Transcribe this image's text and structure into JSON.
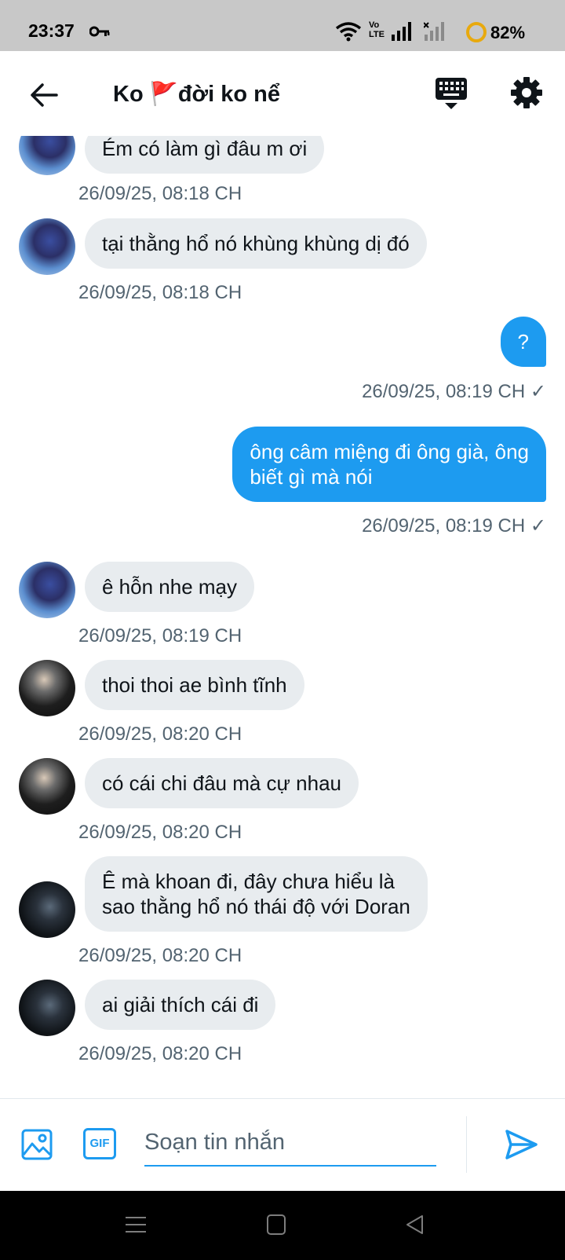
{
  "status_bar": {
    "time": "23:37",
    "volte_top": "Vo",
    "volte_bottom": "LTE",
    "battery": "82%"
  },
  "header": {
    "title": "Ko 🚩đời ko nể"
  },
  "messages": [
    {
      "dir": "in",
      "avatar": "avatar-blue",
      "text": "Ém có làm gì đâu m ơi",
      "time": "26/09/25, 08:18 CH"
    },
    {
      "dir": "in",
      "avatar": "avatar-blue",
      "text": "tại thằng hổ nó khùng khùng dị đó",
      "time": "26/09/25, 08:18 CH"
    },
    {
      "dir": "out",
      "text": "?",
      "time": "26/09/25, 08:19 CH ✓"
    },
    {
      "dir": "out",
      "text": "ông câm miệng đi ông già, ông\nbiết gì mà nói",
      "time": "26/09/25, 08:19 CH ✓"
    },
    {
      "dir": "in",
      "avatar": "avatar-blue",
      "text": "ê hỗn nhe mạy",
      "time": "26/09/25, 08:19 CH"
    },
    {
      "dir": "in",
      "avatar": "avatar-dark",
      "text": "thoi thoi ae bình tĩnh",
      "time": "26/09/25, 08:20 CH"
    },
    {
      "dir": "in",
      "avatar": "avatar-dark",
      "text": "có cái chi đâu mà cự nhau",
      "time": "26/09/25, 08:20 CH"
    },
    {
      "dir": "in",
      "avatar": "avatar-night",
      "text": "Ê mà khoan đi, đây chưa hiểu là\nsao thằng hổ nó thái độ với Doran",
      "time": "26/09/25, 08:20 CH"
    },
    {
      "dir": "in",
      "avatar": "avatar-night",
      "text": "ai giải thích cái đi",
      "time": "26/09/25, 08:20 CH"
    }
  ],
  "composer": {
    "gif_label": "GIF",
    "placeholder": "Soạn tin nhắn",
    "value": ""
  },
  "icons": {
    "back": "arrow-left-icon",
    "keyboard": "keyboard-icon",
    "settings": "gear-icon",
    "image": "image-icon",
    "gif": "gif-icon",
    "send": "send-icon"
  },
  "colors": {
    "accent": "#1d9bf0",
    "incoming_bubble": "#e8ecef",
    "timestamp": "#536471"
  }
}
